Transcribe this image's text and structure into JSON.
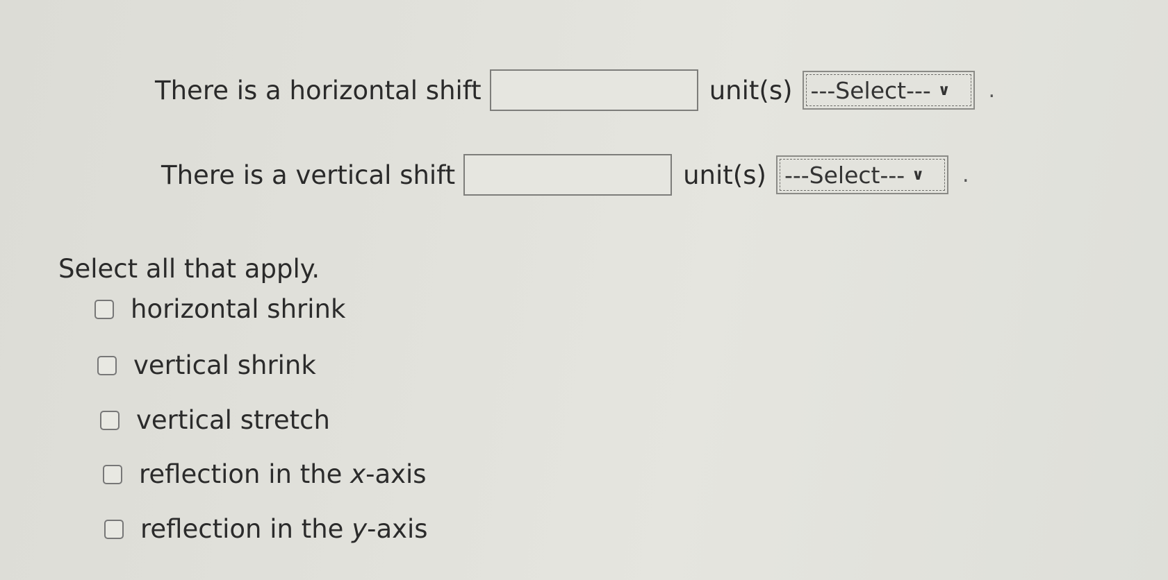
{
  "horizontal_row": {
    "prefix": "There is a horizontal shift",
    "input_value": "",
    "unit_label": "unit(s)",
    "select_value": "---Select---",
    "suffix": "."
  },
  "vertical_row": {
    "prefix": "There is a vertical shift",
    "input_value": "",
    "unit_label": "unit(s)",
    "select_value": "---Select---",
    "suffix": "."
  },
  "prompt": "Select all that apply.",
  "options": [
    {
      "label": "horizontal shrink",
      "checked": false
    },
    {
      "label": "vertical shrink",
      "checked": false
    },
    {
      "label": "vertical stretch",
      "checked": false
    },
    {
      "label_before": "reflection in the ",
      "label_var": "x",
      "label_after": "-axis",
      "checked": false
    },
    {
      "label_before": "reflection in the ",
      "label_var": "y",
      "label_after": "-axis",
      "checked": false
    }
  ],
  "icons": {
    "dropdown": "chevron-down-icon"
  }
}
